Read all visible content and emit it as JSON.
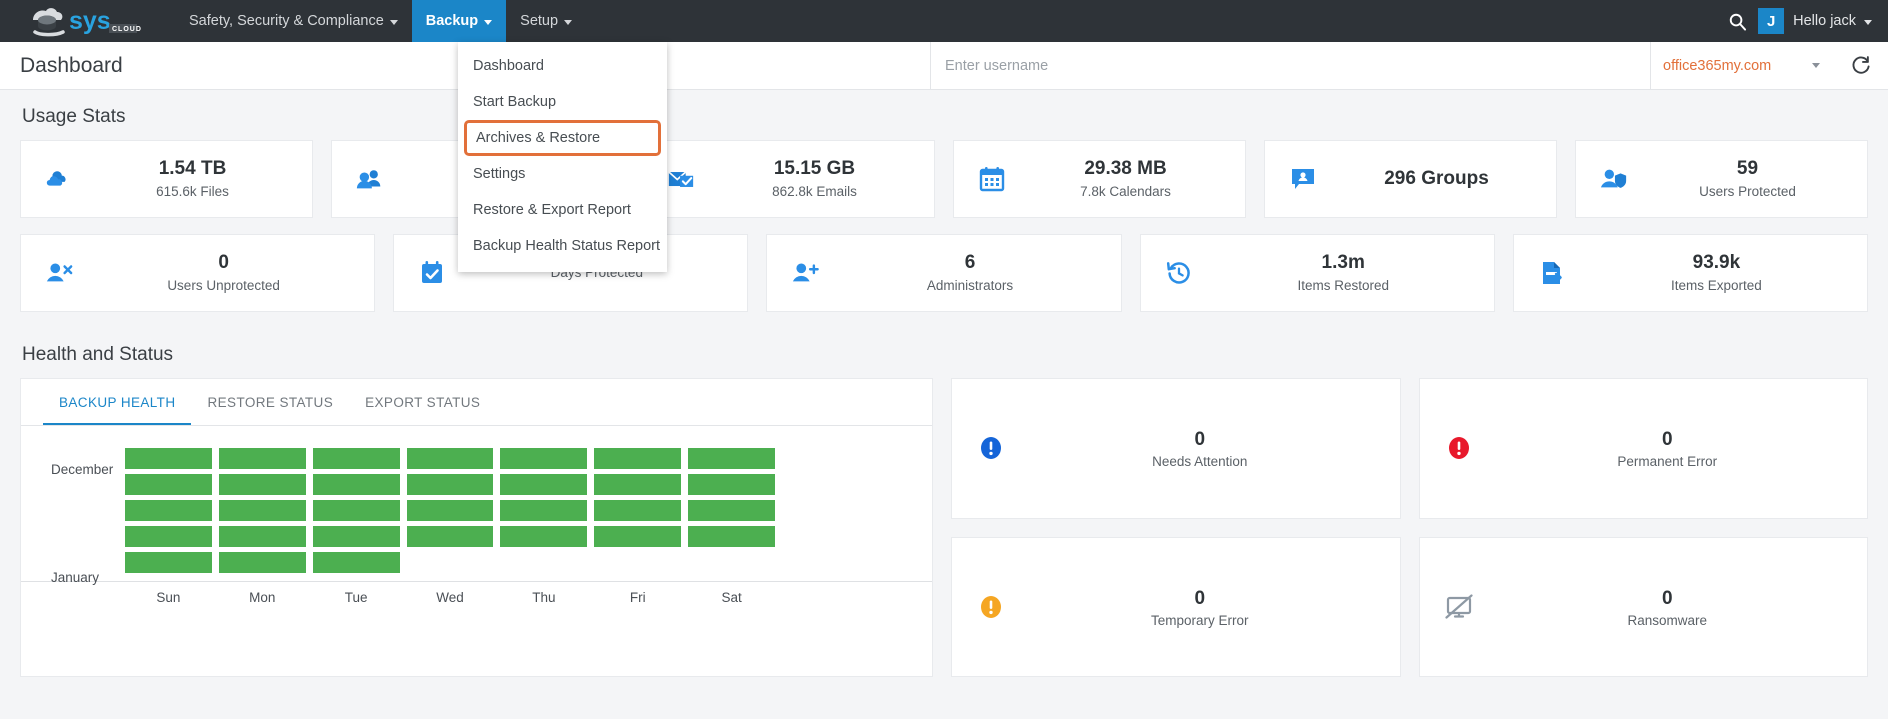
{
  "brand": {
    "logo_text": "sys",
    "logo_sub": "CLOUD",
    "accent_blue": "#1b86c8",
    "accent_orange": "#e2703a",
    "nav_bg": "#2e3338",
    "green": "#4caf50"
  },
  "topnav": {
    "items": [
      {
        "label": "Safety, Security & Compliance",
        "has_caret": true,
        "active": false
      },
      {
        "label": "Backup",
        "has_caret": true,
        "active": true
      },
      {
        "label": "Setup",
        "has_caret": true,
        "active": false
      }
    ],
    "search_icon": "search-icon",
    "avatar_initial": "J",
    "greeting": "Hello jack"
  },
  "dropdown": {
    "open_for": "Backup",
    "items": [
      {
        "label": "Dashboard",
        "highlighted": false
      },
      {
        "label": "Start Backup",
        "highlighted": false
      },
      {
        "label": "Archives & Restore",
        "highlighted": true
      },
      {
        "label": "Settings",
        "highlighted": false
      },
      {
        "label": "Restore & Export Report",
        "highlighted": false
      },
      {
        "label": "Backup Health Status Report",
        "highlighted": false
      }
    ]
  },
  "subheader": {
    "page_title": "Dashboard",
    "username_placeholder": "Enter username",
    "username_value": "",
    "domain_selected": "office365my.com",
    "refresh_icon": "refresh-icon"
  },
  "usage_stats": {
    "title": "Usage Stats",
    "row1": [
      {
        "icon": "cloud-icon",
        "value": "1.54 TB",
        "label": "615.6k Files",
        "inline": false
      },
      {
        "icon": "people-icon",
        "value": "",
        "label": "",
        "inline": false
      },
      {
        "icon": "mail-check-icon",
        "value": "15.15 GB",
        "label": "862.8k Emails",
        "inline": false
      },
      {
        "icon": "calendar-icon",
        "value": "29.38 MB",
        "label": "7.8k Calendars",
        "inline": false
      },
      {
        "icon": "group-chat-icon",
        "value": "296 Groups",
        "label": "",
        "inline": true
      },
      {
        "icon": "user-shield-icon",
        "value": "59",
        "label": "Users Protected",
        "inline": false
      }
    ],
    "row2": [
      {
        "icon": "user-x-icon",
        "value": "0",
        "label": "Users Unprotected",
        "inline": false
      },
      {
        "icon": "calendar-check-icon",
        "value": "",
        "label": "Days Protected",
        "inline": false
      },
      {
        "icon": "user-plus-icon",
        "value": "6",
        "label": "Administrators",
        "inline": false
      },
      {
        "icon": "history-icon",
        "value": "1.3m",
        "label": "Items Restored",
        "inline": false
      },
      {
        "icon": "file-export-icon",
        "value": "93.9k",
        "label": "Items Exported",
        "inline": false
      }
    ]
  },
  "health": {
    "title": "Health and Status",
    "tabs": [
      {
        "label": "BACKUP HEALTH",
        "active": true
      },
      {
        "label": "RESTORE STATUS",
        "active": false
      },
      {
        "label": "EXPORT STATUS",
        "active": false
      }
    ],
    "status_cards": [
      {
        "icon": "info-circle-icon",
        "icon_color": "#1565d8",
        "value": "0",
        "label": "Needs Attention"
      },
      {
        "icon": "error-circle-icon",
        "icon_color": "#e8192c",
        "value": "0",
        "label": "Permanent Error"
      },
      {
        "icon": "warning-circle-icon",
        "icon_color": "#f5a623",
        "value": "0",
        "label": "Temporary Error"
      },
      {
        "icon": "ransomware-screen-icon",
        "icon_color": "#8e99a4",
        "value": "0",
        "label": "Ransomware"
      }
    ]
  },
  "chart_data": {
    "type": "heatmap",
    "title": "Backup Health",
    "xlabel": "",
    "ylabel": "",
    "categories": [
      "Sun",
      "Mon",
      "Tue",
      "Wed",
      "Thu",
      "Fri",
      "Sat"
    ],
    "row_labels": [
      "December",
      "",
      "",
      "",
      "January"
    ],
    "month_start_label": "December",
    "month_end_label": "January",
    "legend": [],
    "grid": false,
    "color_healthy": "#4caf50",
    "color_empty": "#ffffff",
    "values": [
      [
        1,
        1,
        1,
        1,
        1,
        1,
        1
      ],
      [
        1,
        1,
        1,
        1,
        1,
        1,
        1
      ],
      [
        1,
        1,
        1,
        1,
        1,
        1,
        1
      ],
      [
        1,
        1,
        1,
        1,
        1,
        1,
        1
      ],
      [
        1,
        1,
        1,
        0,
        0,
        0,
        0
      ]
    ]
  }
}
